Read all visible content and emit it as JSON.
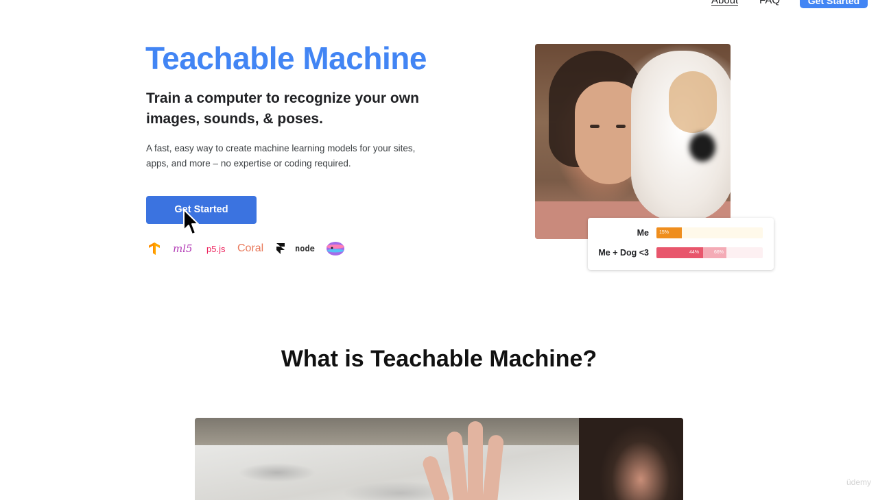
{
  "nav": {
    "menu_icon": "hamburger-menu-icon",
    "about": "About",
    "faq": "FAQ",
    "get_started": "Get Started"
  },
  "hero": {
    "title": "Teachable Machine",
    "subtitle": "Train a computer to recognize your own images, sounds, & poses.",
    "description": "A fast, easy way to create machine learning models for your sites, apps, and more – no expertise or coding required.",
    "cta": "Get Started"
  },
  "logos": {
    "tensorflow_icon": "tensorflow-logo-icon",
    "ml5": "ml5",
    "p5": "p5.js",
    "coral": "Coral",
    "framer_icon": "framer-logo-icon",
    "node": "node",
    "glitch_icon": "glitch-logo-icon"
  },
  "demo": {
    "results": [
      {
        "label": "Me",
        "pct_text": "15%",
        "fill_pct": 24,
        "color": "#ef8e1e",
        "track": "#fff9ea",
        "ghost_pct": 0,
        "ghost_text": ""
      },
      {
        "label": "Me + Dog <3",
        "pct_text": "44%",
        "fill_pct": 44,
        "color": "#e8566c",
        "track": "#fdf0f2",
        "ghost_pct": 22,
        "ghost_text": "66%"
      }
    ]
  },
  "section": {
    "title": "What is Teachable Machine?"
  },
  "colors": {
    "brand_blue": "#4285f4",
    "button_blue": "#3b73e0",
    "me_orange": "#ef8e1e",
    "dog_pink": "#e8566c"
  },
  "watermark": "üdemy"
}
